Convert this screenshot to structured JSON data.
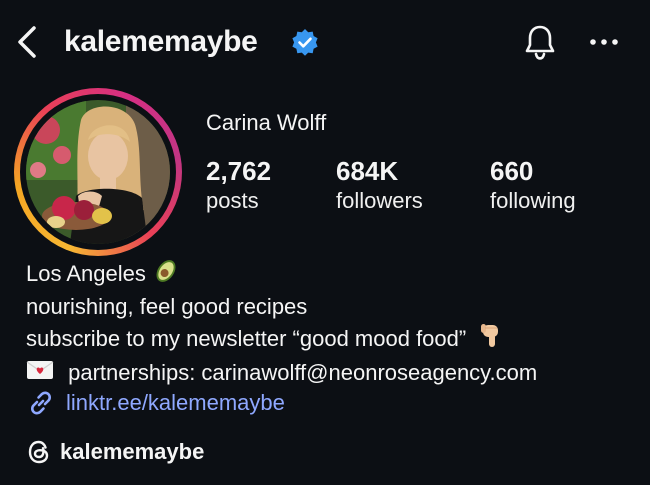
{
  "header": {
    "username": "kalememaybe",
    "icons": {
      "back": "chevron-left-icon",
      "verified": "verified-badge-icon",
      "bell": "bell-icon",
      "more": "more-dots-icon"
    },
    "verified_color": "#3897f0"
  },
  "profile": {
    "full_name": "Carina Wolff",
    "stats": [
      {
        "value": "2,762",
        "label": "posts"
      },
      {
        "value": "684K",
        "label": "followers"
      },
      {
        "value": "660",
        "label": "following"
      }
    ]
  },
  "bio": {
    "line1": "Los Angeles",
    "line1_emoji": "avocado-icon",
    "line2": "nourishing, feel good recipes",
    "line3": "subscribe to my newsletter “good mood food”",
    "line3_emoji": "pointing-down-hand-icon",
    "line4": "partnerships: carinawolff@neonroseagency.com",
    "line4_emoji": "love-letter-icon"
  },
  "link": {
    "text": "linktr.ee/kalememaybe",
    "icon": "link-icon",
    "color": "#8fa8ff"
  },
  "threads": {
    "handle": "kalememaybe",
    "icon": "threads-icon"
  }
}
